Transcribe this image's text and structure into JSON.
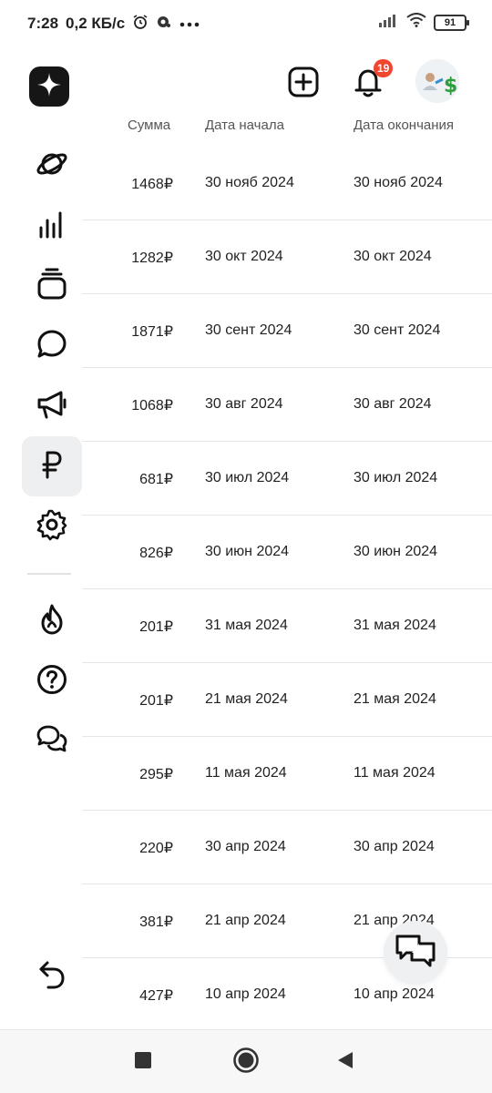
{
  "status_bar": {
    "time": "7:28",
    "speed": "0,2 КБ/с",
    "battery": "91",
    "icons": [
      "alarm-icon",
      "app-icon",
      "more-dots-icon",
      "signal-icon",
      "wifi-icon",
      "battery-icon"
    ]
  },
  "header": {
    "logo_icon": "sparkle-star-icon",
    "add_icon": "plus-square-icon",
    "bell_icon": "bell-icon",
    "notification_count": "19",
    "avatar": "profile-avatar"
  },
  "sidebar": {
    "items": [
      {
        "icon": "planet-icon",
        "active": false
      },
      {
        "icon": "bar-chart-icon",
        "active": false
      },
      {
        "icon": "stack-icon",
        "active": false
      },
      {
        "icon": "chat-bubble-icon",
        "active": false
      },
      {
        "icon": "megaphone-icon",
        "active": false
      },
      {
        "icon": "ruble-icon",
        "active": true
      },
      {
        "icon": "gear-icon",
        "active": false
      },
      {
        "icon": "fire-icon",
        "active": false
      },
      {
        "icon": "help-icon",
        "active": false
      },
      {
        "icon": "chats-icon",
        "active": false
      },
      {
        "icon": "undo-arrow-icon",
        "active": false
      }
    ]
  },
  "table": {
    "headers": {
      "sum": "Сумма",
      "start": "Дата начала",
      "end": "Дата окончания"
    },
    "rows": [
      {
        "sum": "1468₽",
        "start": "30 нояб 2024",
        "end": "30 нояб 2024"
      },
      {
        "sum": "1282₽",
        "start": "30 окт 2024",
        "end": "30 окт 2024"
      },
      {
        "sum": "1871₽",
        "start": "30 сент 2024",
        "end": "30 сент 2024"
      },
      {
        "sum": "1068₽",
        "start": "30 авг 2024",
        "end": "30 авг 2024"
      },
      {
        "sum": "681₽",
        "start": "30 июл 2024",
        "end": "30 июл 2024"
      },
      {
        "sum": "826₽",
        "start": "30 июн 2024",
        "end": "30 июн 2024"
      },
      {
        "sum": "201₽",
        "start": "31 мая 2024",
        "end": "31 мая 2024"
      },
      {
        "sum": "201₽",
        "start": "21 мая 2024",
        "end": "21 мая 2024"
      },
      {
        "sum": "295₽",
        "start": "11 мая 2024",
        "end": "11 мая 2024"
      },
      {
        "sum": "220₽",
        "start": "30 апр 2024",
        "end": "30 апр 2024"
      },
      {
        "sum": "381₽",
        "start": "21 апр 2024",
        "end": "21 апр 2024"
      },
      {
        "sum": "427₽",
        "start": "10 апр 2024",
        "end": "10 апр 2024"
      }
    ]
  },
  "fab": {
    "icon": "chats-icon"
  },
  "navbar": {
    "icons": [
      "recents-square-icon",
      "home-circle-icon",
      "back-triangle-icon"
    ]
  },
  "colors": {
    "badge": "#f0452f",
    "logo_bg": "#161616",
    "active_bg": "#eeeff1"
  }
}
